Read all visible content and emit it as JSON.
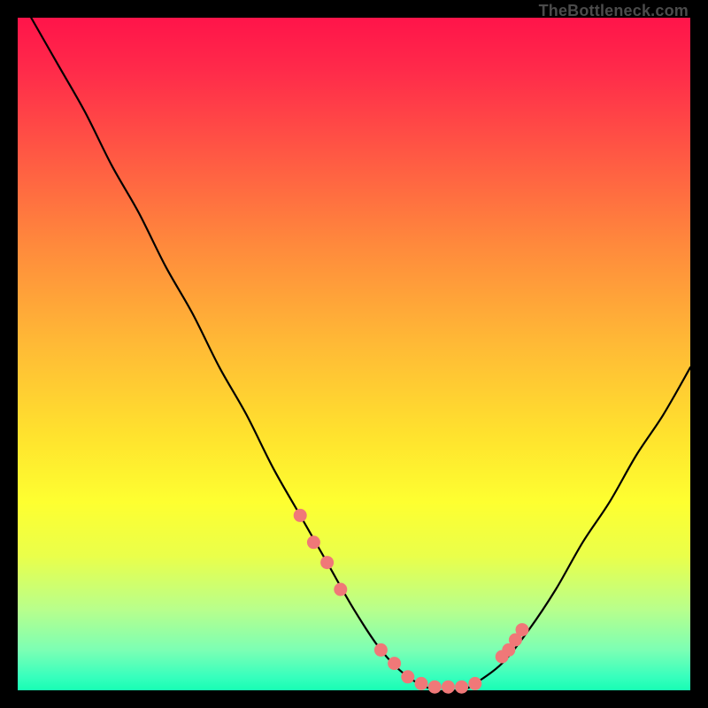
{
  "watermark": "TheBottleneck.com",
  "chart_data": {
    "type": "line",
    "title": "",
    "xlabel": "",
    "ylabel": "",
    "xlim": [
      0,
      100
    ],
    "ylim": [
      0,
      100
    ],
    "grid": false,
    "series": [
      {
        "name": "bottleneck-curve",
        "x": [
          2,
          6,
          10,
          14,
          18,
          22,
          26,
          30,
          34,
          38,
          42,
          46,
          50,
          54,
          58,
          62,
          64,
          66,
          68,
          72,
          76,
          80,
          84,
          88,
          92,
          96,
          100
        ],
        "y": [
          100,
          93,
          86,
          78,
          71,
          63,
          56,
          48,
          41,
          33,
          26,
          19,
          12,
          6,
          2,
          0,
          0,
          0,
          1,
          4,
          9,
          15,
          22,
          28,
          35,
          41,
          48
        ]
      }
    ],
    "markers": {
      "name": "highlight-dots",
      "color": "#f07878",
      "x": [
        42,
        44,
        46,
        48,
        54,
        56,
        58,
        60,
        62,
        64,
        66,
        68,
        72,
        73,
        74,
        75
      ],
      "y": [
        26,
        22,
        19,
        15,
        6,
        4,
        2,
        1,
        0.5,
        0.5,
        0.5,
        1.0,
        5,
        6,
        7.5,
        9
      ]
    }
  },
  "colors": {
    "curve": "#000000",
    "marker": "#f07878",
    "background_top": "#ff144a",
    "background_bottom": "#18feb4"
  }
}
